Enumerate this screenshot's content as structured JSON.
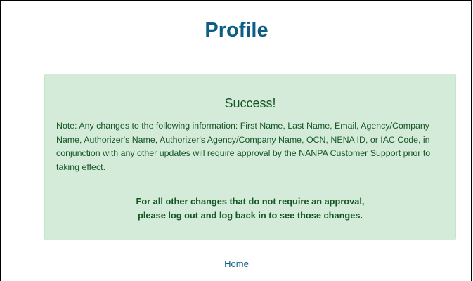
{
  "page": {
    "title": "Profile"
  },
  "alert": {
    "heading": "Success!",
    "note": "Note: Any changes to the following information: First Name, Last Name, Email, Agency/Company Name, Authorizer's Name, Authorizer's Agency/Company Name, OCN, NENA ID, or IAC Code, in conjunction with any other updates will require approval by the NANPA Customer Support prior to taking effect.",
    "strong_line1": "For all other changes that do not require an approval,",
    "strong_line2": "please log out and log back in to see those changes."
  },
  "nav": {
    "home_label": "Home"
  },
  "colors": {
    "title": "#0d5d86",
    "alert_bg": "#d4ebd9",
    "alert_text": "#155724",
    "link": "#0d5d86"
  }
}
